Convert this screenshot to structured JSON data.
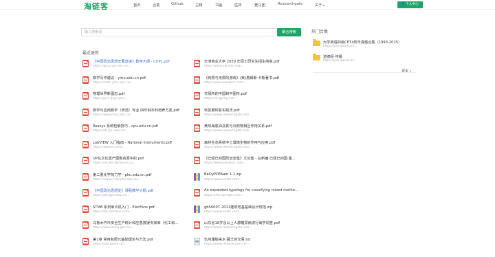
{
  "header": {
    "logo": "淘链客",
    "nav": [
      "首页",
      "合集",
      "Github",
      "古籍",
      "书画",
      "医药",
      "登马团",
      "Researchgate",
      "关于"
    ],
    "user_center": "个人中心"
  },
  "search": {
    "placeholder": "输入搜索词",
    "button": "聚合搜索"
  },
  "recent": {
    "title": "最近更新",
    "items": [
      {
        "name": "《中国政治思想史著选读》教学大纲 - CUPL.pdf",
        "url": "https://gjxy.cupl.edu.cn/...",
        "type": "pdf",
        "link": true
      },
      {
        "name": "天津商业大学 2020 年硕士研究生招生简章.pdf",
        "url": "https://www.yanxian.org/...",
        "type": "pdf",
        "link": false
      },
      {
        "name": "数学写作建议 - ymu.edu.cn.pdf",
        "url": "https://math.ymu.edu.cn/...",
        "type": "pdf",
        "link": false
      },
      {
        "name": "《有限与无限的游戏》(美)詹姆斯·卡斯著书.pdf",
        "url": "https://www.abook01.com/...",
        "type": "pdf",
        "link": false
      },
      {
        "name": "物理世界新图志.pdf",
        "url": "https://jyc1.tjsjy.com/...",
        "type": "pdf",
        "link": false
      },
      {
        "name": "交易所的中国和平图形.pdf",
        "url": "https://m.ggcng.net/...",
        "type": "pdf",
        "link": false
      },
      {
        "name": "数学与应用数学（师范）专业 四年制本科培养方案.pdf",
        "url": "https://www.chnu.edu.cn/...",
        "type": "pdf",
        "link": false
      },
      {
        "name": "恢复期恢复实践法.pdf",
        "url": "https://www.researchgate.net/...",
        "type": "pdf",
        "link": false
      },
      {
        "name": "Reasys 系统检索技巧 - cpu.edu.cn.pdf",
        "url": "https://lib.cpu.edu.cn/...",
        "type": "pdf",
        "link": false
      },
      {
        "name": "黄热海底油及其与沉积物相互作用关系.pdf",
        "url": "https://www.researchgate.net/...",
        "type": "pdf",
        "link": false
      },
      {
        "name": "LabVIEW 入门指南 - National Instruments.pdf",
        "url": "https://www.ni.com/...",
        "type": "pdf",
        "link": false
      },
      {
        "name": "森林生态系统中土壤微生物的作用与应用.pdf",
        "url": "https://www.researchgate.net/...",
        "type": "pdf",
        "link": false
      },
      {
        "name": "UP在文化遗产图像资源中的.pdf",
        "url": "https://society.library.sh.cn/...",
        "type": "pdf",
        "link": false
      },
      {
        "name": "《已经已四国政治全集》文论集 - 在新编·已经已四国·集...",
        "url": "https://www.abook01.com/...",
        "type": "pdf",
        "link": false
      },
      {
        "name": "第二量化学热力学 - pku.edu.cn.pdf",
        "url": "https://www2.now.pku.edu.cn/...",
        "type": "pdf",
        "link": false
      },
      {
        "name": "BeOyPDFAam 1.1.zip",
        "url": "https://www.duote.com/...",
        "type": "zip",
        "link": false
      },
      {
        "name": "《中国政治思想史》课程教学大纲.pdf",
        "url": "https://jwc.gyu.edu.cn/...",
        "type": "pdf",
        "link": true
      },
      {
        "name": "An expanded typology for classifying mixed metho...",
        "url": "https://link.springer.com/...",
        "type": "pdf",
        "link": false
      },
      {
        "name": "STM8 系列单片机入门 - ElecFans.pdf",
        "url": "https://file.elecfans.com/...",
        "type": "pdf",
        "link": false
      },
      {
        "name": "gb50007-2011建筑地基基础设计规范.zip",
        "url": "https://www.duote.com/...",
        "type": "zip",
        "link": false
      },
      {
        "name": "乌鲁木齐市安全生产统计和应急救援专家库（化工和...",
        "url": "https://www.wlmq.gov.cn/...",
        "type": "pdf",
        "link": false
      },
      {
        "name": "山东省18岁及以上人群糖尿病流行病学调查.pdf",
        "url": "https://www.researchgate.net/...",
        "type": "pdf",
        "link": false
      },
      {
        "name": "第1章 常用有限元基础理论与方法.pdf",
        "url": "https://pan.quark.cn/...",
        "type": "pdf",
        "link": false
      },
      {
        "name": "仇鸠潘腔采水·蔓王的交易.txt",
        "url": "https://www.txtbook.com.cn/...",
        "type": "txt",
        "link": false
      }
    ]
  },
  "hot": {
    "title": "热门合集",
    "items": [
      {
        "name": "大学英语四级CET4历年真题合集（1993-2015）",
        "url": "https://pan.quark.cn/..."
      },
      {
        "name": "道德经·传播",
        "url": "https://pan.quark.cn/..."
      }
    ],
    "more": "更多 »"
  },
  "colors": {
    "brand": "#1fa463",
    "link": "#3a6fd8",
    "pdf": "#e84c3d",
    "folder": "#f6c33f"
  }
}
